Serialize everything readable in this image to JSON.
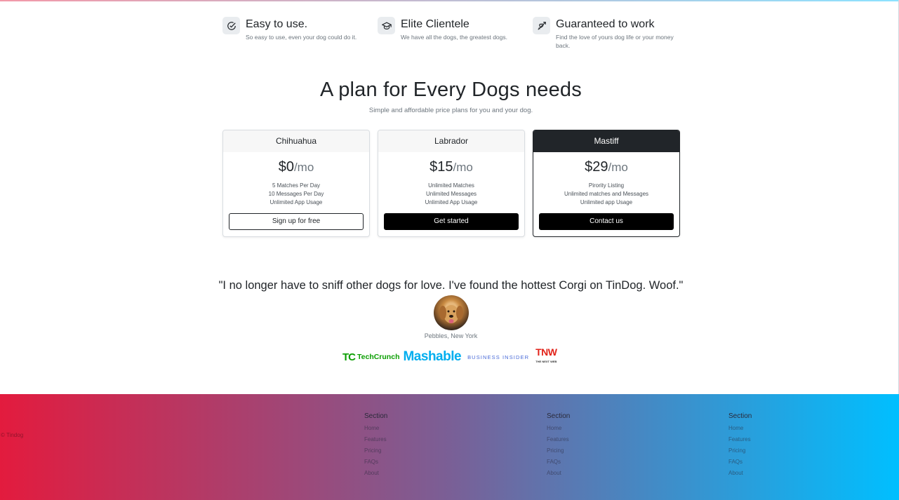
{
  "features": [
    {
      "icon": "check-circle-icon",
      "title": "Easy to use.",
      "text": "So easy to use, even your dog could do it."
    },
    {
      "icon": "mortarboard-icon",
      "title": "Elite Clientele",
      "text": "We have all the dogs, the greatest dogs."
    },
    {
      "icon": "arrow-through-heart-icon",
      "title": "Guaranteed to work",
      "text": "Find the love of yours dog life or your money back."
    }
  ],
  "pricing": {
    "title": "A plan for Every Dogs needs",
    "subtitle": "Simple and affordable price plans for you and your dog.",
    "plans": [
      {
        "name": "Chihuahua",
        "price": "$0",
        "per": "/mo",
        "features": [
          "5 Matches Per Day",
          "10 Messages Per Day",
          "Unlimited App Usage"
        ],
        "button": "Sign up for free"
      },
      {
        "name": "Labrador",
        "price": "$15",
        "per": "/mo",
        "features": [
          "Unlimited Matches",
          "Unlimited Messages",
          "Unlimited App Usage"
        ],
        "button": "Get started"
      },
      {
        "name": "Mastiff",
        "price": "$29",
        "per": "/mo",
        "features": [
          "Pirority Listing",
          "Unlimited matches and Messages",
          "Unlimited app Usage"
        ],
        "button": "Contact us"
      }
    ]
  },
  "testimonial": {
    "quote": "\"I no longer have to sniff other dogs for love. I've found the hottest Corgi on TinDog. Woof.\"",
    "author": "Pebbles, New York"
  },
  "press": {
    "techcrunch_mark": "TC",
    "techcrunch": "TechCrunch",
    "mashable": "Mashable",
    "business_insider": "BUSINESS INSIDER",
    "tnw": "TNW",
    "tnw_small": "THE NEXT WEB"
  },
  "footer": {
    "copyright": "© Tindog",
    "columns": [
      {
        "heading": "Section",
        "links": [
          "Home",
          "Features",
          "Pricing",
          "FAQs",
          "About"
        ]
      },
      {
        "heading": "Section",
        "links": [
          "Home",
          "Features",
          "Pricing",
          "FAQs",
          "About"
        ]
      },
      {
        "heading": "Section",
        "links": [
          "Home",
          "Features",
          "Pricing",
          "FAQs",
          "About"
        ]
      }
    ]
  },
  "colors": {
    "footer_gradient_start": "#e31b3e",
    "footer_gradient_end": "#00bfff",
    "dark": "#212529"
  }
}
